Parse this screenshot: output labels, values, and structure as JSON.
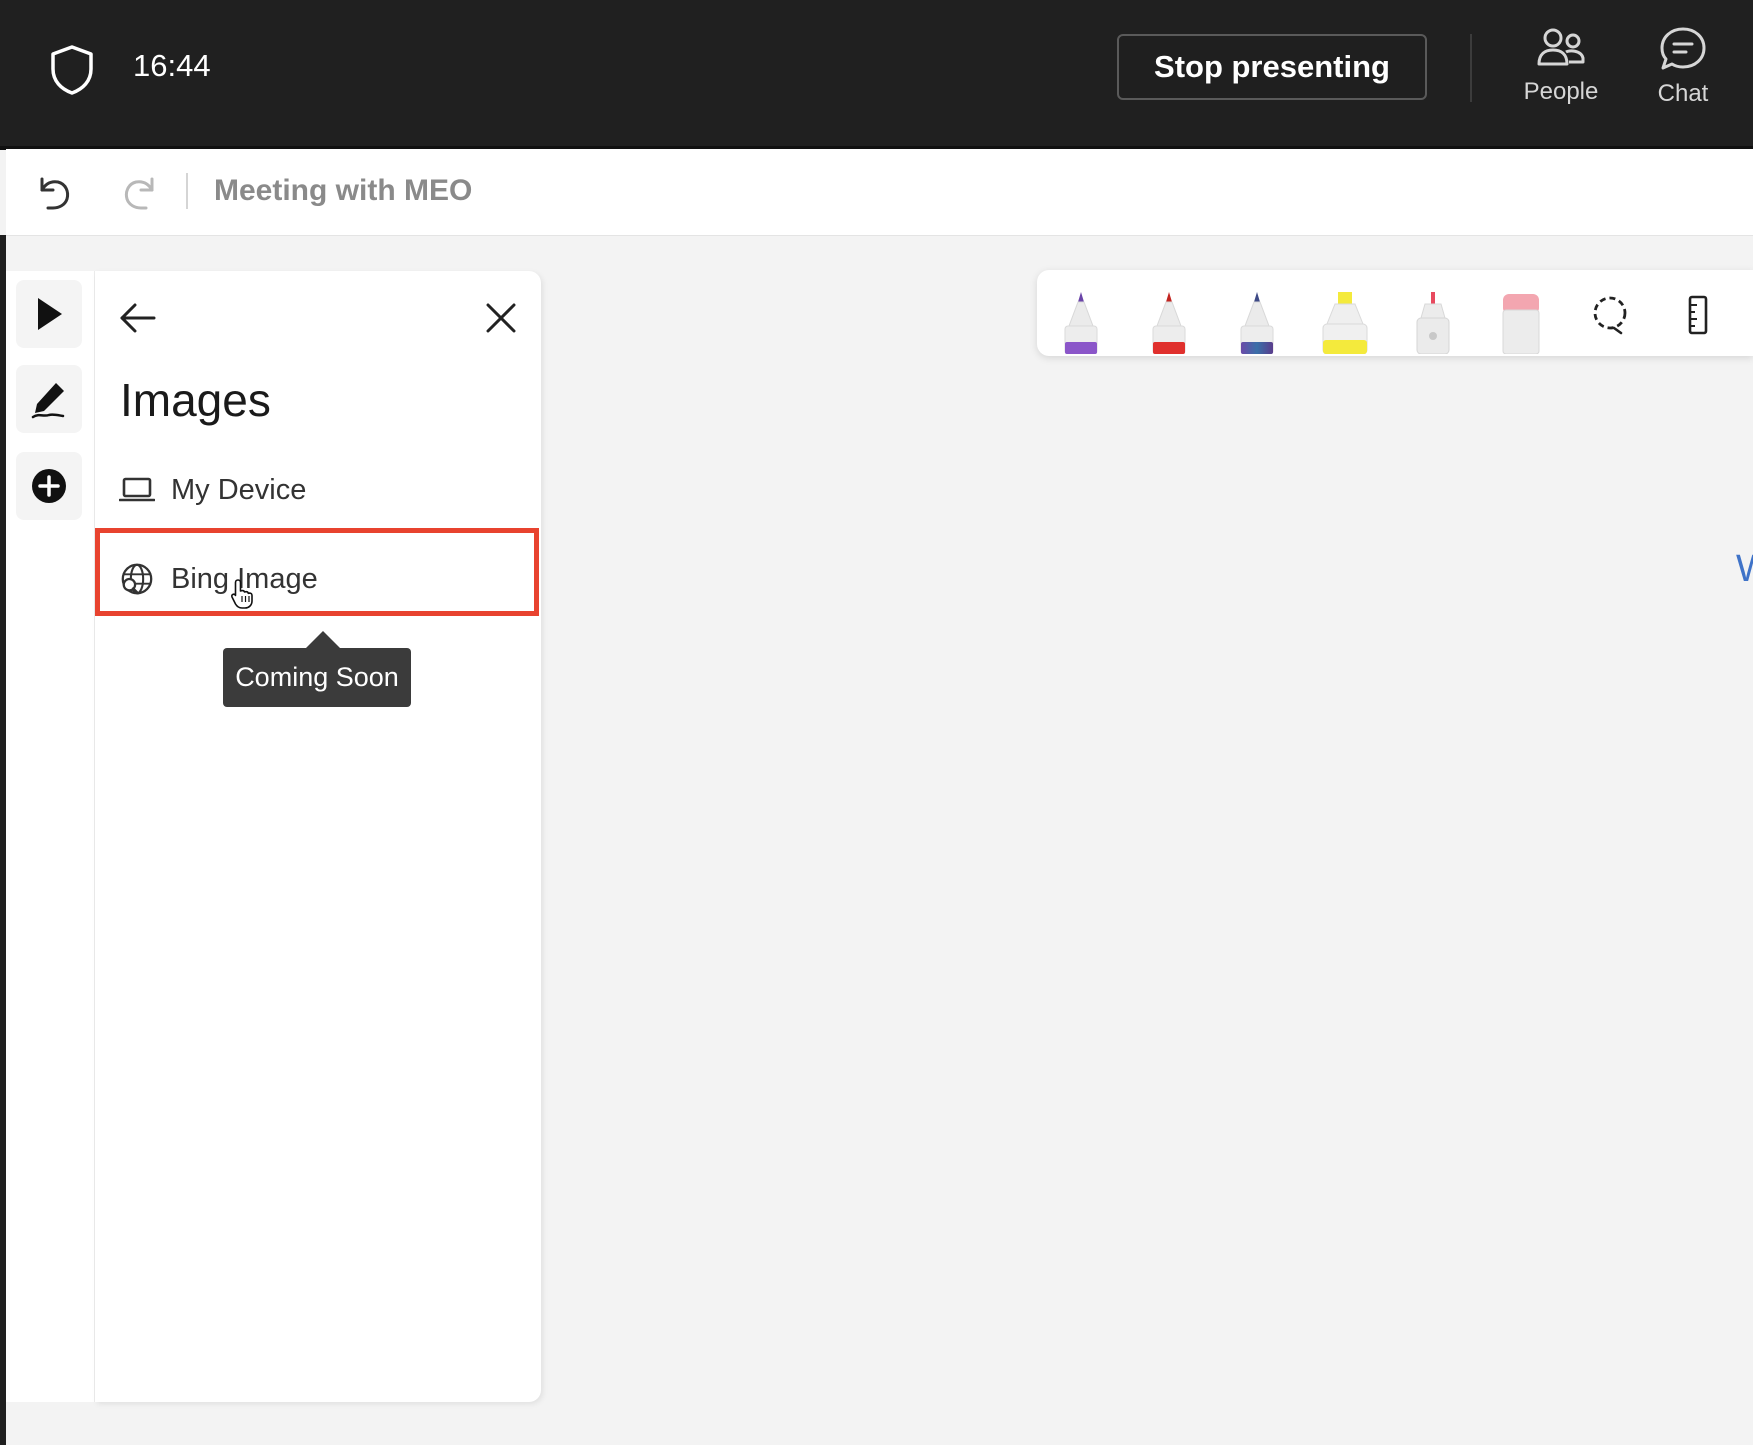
{
  "meeting_bar": {
    "time": "16:44",
    "stop_presenting_label": "Stop presenting",
    "actions": [
      {
        "label": "People",
        "icon": "people-icon"
      },
      {
        "label": "Chat",
        "icon": "chat-icon"
      }
    ]
  },
  "header": {
    "title": "Meeting with MEO",
    "undo_icon": "undo-icon",
    "redo_icon": "redo-icon"
  },
  "tool_rail": {
    "tools": [
      {
        "icon": "select-arrow-icon"
      },
      {
        "icon": "pen-icon"
      },
      {
        "icon": "add-circle-icon"
      }
    ]
  },
  "images_panel": {
    "title": "Images",
    "items": [
      {
        "label": "My Device",
        "icon": "laptop-icon"
      },
      {
        "label": "Bing Image",
        "icon": "globe-search-icon"
      }
    ],
    "tooltip": "Coming Soon"
  },
  "pen_toolbar": {
    "tools": [
      {
        "name": "purple-pen",
        "color": "#8b56c9"
      },
      {
        "name": "red-pen",
        "color": "#e0302d"
      },
      {
        "name": "galaxy-pen",
        "color": "#4a5fa8"
      },
      {
        "name": "yellow-highlighter",
        "color": "#f4ea3c"
      },
      {
        "name": "laser-pointer",
        "color": "#e84a5f"
      },
      {
        "name": "eraser",
        "color": "#f3a6b0"
      },
      {
        "name": "lasso-select",
        "icon": "lasso-icon"
      },
      {
        "name": "ruler",
        "icon": "ruler-icon"
      }
    ]
  },
  "canvas": {
    "edge_text": "W"
  },
  "colors": {
    "meeting_bar_bg": "#202020",
    "highlight": "#e8432f",
    "tooltip_bg": "#3b3b3b",
    "canvas_bg": "#f3f3f3"
  }
}
